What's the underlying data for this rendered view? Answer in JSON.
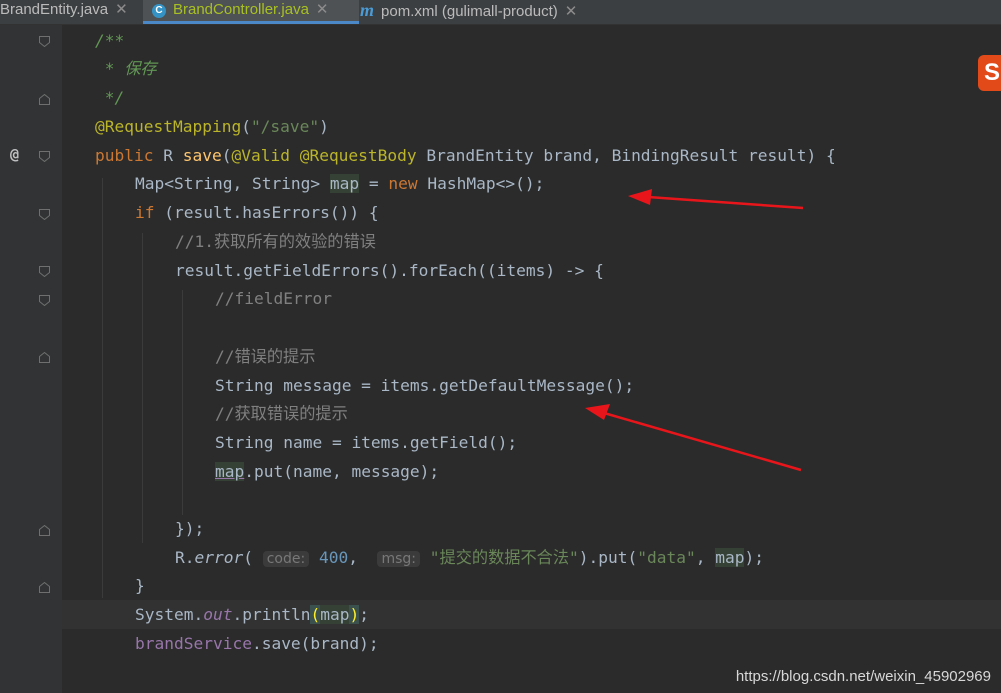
{
  "tabs": [
    {
      "label": "BrandEntity.java",
      "icon": "java-class-icon",
      "active": false
    },
    {
      "label": "BrandController.java",
      "icon": "c-class-icon",
      "active": true
    },
    {
      "label": "pom.xml (gulimall-product)",
      "icon": "maven-icon",
      "active": false
    }
  ],
  "close_glyph": "✕",
  "gutter": {
    "override_marker": "@"
  },
  "code": {
    "l1": "/**",
    "l2": " * 保存",
    "l3": " */",
    "l4_ann": "@RequestMapping",
    "l4_str": "\"/save\"",
    "l5_kw": "public",
    "l5_type": "R",
    "l5_method": "save",
    "l5_ann1": "@Valid",
    "l5_ann2": "@RequestBody",
    "l5_rest": "BrandEntity brand, BindingResult result) {",
    "l6_a": "Map<String, String> ",
    "l6_var": "map",
    "l6_b": " = ",
    "l6_kw": "new",
    "l6_c": " HashMap<>();",
    "l7_kw": "if",
    "l7_rest": " (result.hasErrors()) {",
    "l8": "//1.获取所有的效验的错误",
    "l9": "result.getFieldErrors().forEach((items) -> {",
    "l10": "//fieldError",
    "l11": "//错误的提示",
    "l12": "String message = items.getDefaultMessage();",
    "l13": "//获取错误的提示",
    "l14": "String name = items.getField();",
    "l15_var": "map",
    "l15_rest": ".put(name, message);",
    "l16": "});",
    "l17_a": "R.",
    "l17_method": "error",
    "l17_hint1": "code:",
    "l17_num": "400",
    "l17_hint2": "msg:",
    "l17_str1": "\"提交的数据不合法\"",
    "l17_b": ").put(",
    "l17_str2": "\"data\"",
    "l17_var": "map",
    "l18": "}",
    "l19_a": "System.",
    "l19_field": "out",
    "l19_b": ".println",
    "l19_var": "map",
    "l20_field": "brandService",
    "l20_rest": ".save(brand);"
  },
  "watermark": "https://blog.csdn.net/weixin_45902969",
  "logo_letter": "S",
  "colors": {
    "background": "#2b2b2b",
    "keyword": "#cc7832",
    "string": "#6a8759",
    "comment": "#629755",
    "annotation": "#bbb529",
    "method": "#ffc66d",
    "field": "#9876aa",
    "number": "#6897bb",
    "arrow": "#e8161b"
  }
}
